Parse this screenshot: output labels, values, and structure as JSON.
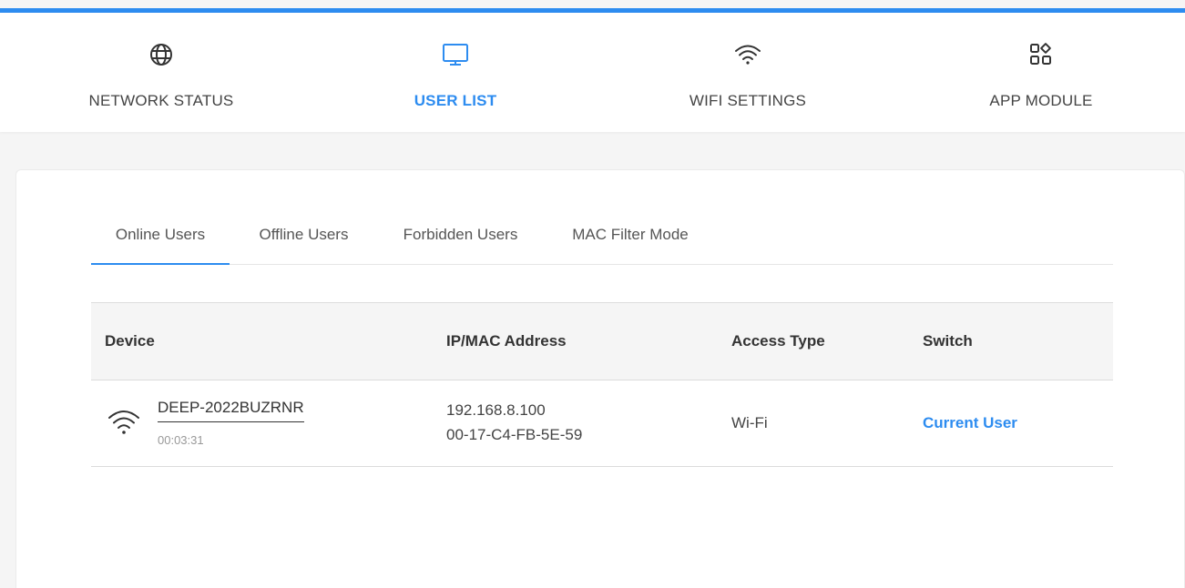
{
  "nav": {
    "items": [
      {
        "label": "NETWORK STATUS",
        "icon": "globe-icon"
      },
      {
        "label": "USER LIST",
        "icon": "monitor-icon"
      },
      {
        "label": "WIFI SETTINGS",
        "icon": "wifi-icon"
      },
      {
        "label": "APP MODULE",
        "icon": "apps-grid-icon"
      }
    ],
    "active_index": 1
  },
  "tabs": [
    {
      "label": "Online Users"
    },
    {
      "label": "Offline Users"
    },
    {
      "label": "Forbidden Users"
    },
    {
      "label": "MAC Filter Mode"
    }
  ],
  "active_tab": 0,
  "table": {
    "headers": [
      "Device",
      "IP/MAC Address",
      "Access Type",
      "Switch"
    ],
    "rows": [
      {
        "icon": "wifi-icon",
        "device_name": "DEEP-2022BUZRNR",
        "online_time": "00:03:31",
        "ip": "192.168.8.100",
        "mac": "00-17-C4-FB-5E-59",
        "access_type": "Wi-Fi",
        "switch": "Current User"
      }
    ]
  },
  "colors": {
    "accent": "#2d8cf0",
    "background": "#f5f5f5",
    "panel": "#ffffff"
  }
}
